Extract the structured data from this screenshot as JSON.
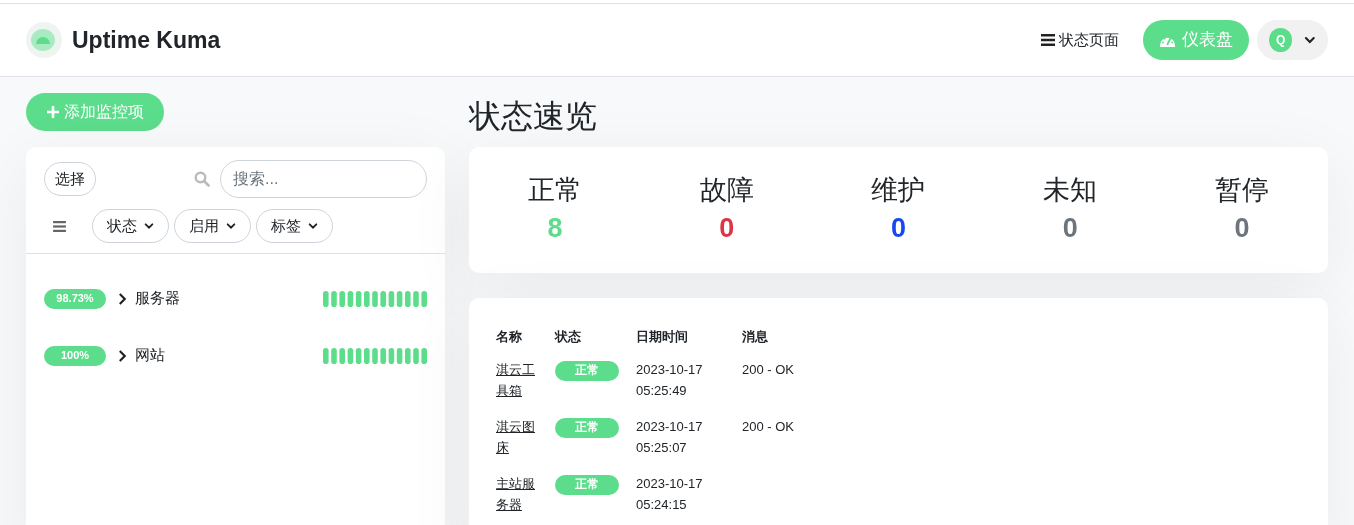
{
  "header": {
    "brand": "Uptime Kuma",
    "status_page_link": "状态页面",
    "dashboard_button": "仪表盘",
    "avatar_letter": "Q"
  },
  "sidebar": {
    "add_button": "添加监控项",
    "select_button": "选择",
    "search": {
      "placeholder": "搜索..."
    },
    "filters": [
      "状态",
      "启用",
      "标签"
    ],
    "monitors": [
      {
        "uptime": "98.73%",
        "name": "服务器"
      },
      {
        "uptime": "100%",
        "name": "网站"
      }
    ]
  },
  "overview": {
    "title": "状态速览",
    "stats": [
      {
        "label": "正常",
        "value": "8",
        "kind": "up"
      },
      {
        "label": "故障",
        "value": "0",
        "kind": "down"
      },
      {
        "label": "维护",
        "value": "0",
        "kind": "maintenance"
      },
      {
        "label": "未知",
        "value": "0",
        "kind": "unknown"
      },
      {
        "label": "暂停",
        "value": "0",
        "kind": "paused"
      }
    ]
  },
  "events": {
    "columns": [
      "名称",
      "状态",
      "日期时间",
      "消息"
    ],
    "rows": [
      {
        "name": "淇云工具箱",
        "status": "正常",
        "kind": "up",
        "datetime": [
          "2023-10-17",
          "05:25:49"
        ],
        "message": "200 - OK"
      },
      {
        "name": "淇云图床",
        "status": "正常",
        "kind": "up",
        "datetime": [
          "2023-10-17",
          "05:25:07"
        ],
        "message": "200 - OK"
      },
      {
        "name": "主站服务器",
        "status": "正常",
        "kind": "up",
        "datetime": [
          "2023-10-17",
          "05:24:15"
        ]
      }
    ]
  }
}
